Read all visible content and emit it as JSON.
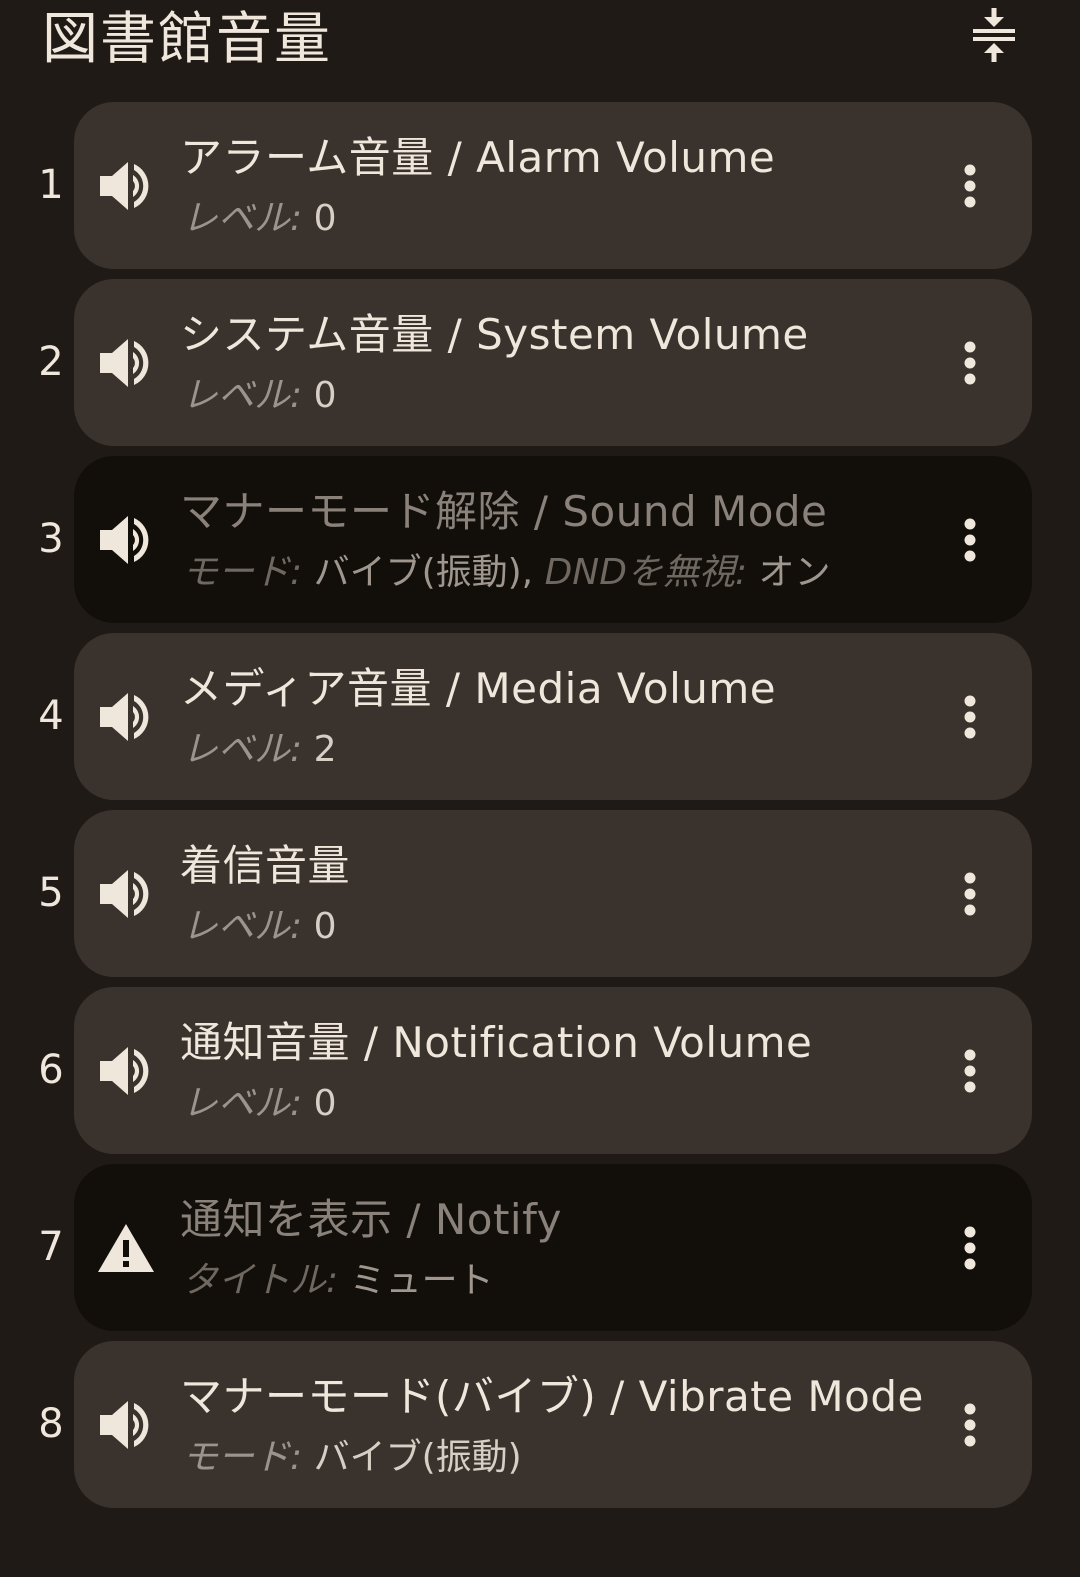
{
  "header": {
    "title": "図書館音量",
    "collapse_icon": "collapse-vertical-icon"
  },
  "colors": {
    "background": "#201a16",
    "card": "#3a322d",
    "card_disabled": "#120e0a",
    "text": "#efe6dc"
  },
  "items": [
    {
      "number": "1",
      "icon": "speaker-icon",
      "title": "アラーム音量 / Alarm Volume",
      "sub_label": "レベル:",
      "sub_value": " 0",
      "sub_label2": "",
      "sub_value2": "",
      "enabled": true
    },
    {
      "number": "2",
      "icon": "speaker-icon",
      "title": "システム音量 / System Volume",
      "sub_label": "レベル:",
      "sub_value": " 0",
      "sub_label2": "",
      "sub_value2": "",
      "enabled": true
    },
    {
      "number": "3",
      "icon": "speaker-icon",
      "title": "マナーモード解除 / Sound Mode",
      "sub_label": "モード:",
      "sub_value": " バイブ(振動),",
      "sub_label2": " DNDを無視:",
      "sub_value2": " オン",
      "enabled": false
    },
    {
      "number": "4",
      "icon": "speaker-icon",
      "title": "メディア音量 / Media Volume",
      "sub_label": "レベル:",
      "sub_value": " 2",
      "sub_label2": "",
      "sub_value2": "",
      "enabled": true
    },
    {
      "number": "5",
      "icon": "speaker-icon",
      "title": "着信音量",
      "sub_label": "レベル:",
      "sub_value": " 0",
      "sub_label2": "",
      "sub_value2": "",
      "enabled": true
    },
    {
      "number": "6",
      "icon": "speaker-icon",
      "title": "通知音量 / Notification Volume",
      "sub_label": "レベル:",
      "sub_value": " 0",
      "sub_label2": "",
      "sub_value2": "",
      "enabled": true
    },
    {
      "number": "7",
      "icon": "warning-icon",
      "title": "通知を表示 / Notify",
      "sub_label": "タイトル:",
      "sub_value": " ミュート",
      "sub_label2": "",
      "sub_value2": "",
      "enabled": false
    },
    {
      "number": "8",
      "icon": "speaker-icon",
      "title": "マナーモード(バイブ) / Vibrate Mode",
      "sub_label": "モード:",
      "sub_value": " バイブ(振動)",
      "sub_label2": "",
      "sub_value2": "",
      "enabled": true
    }
  ]
}
